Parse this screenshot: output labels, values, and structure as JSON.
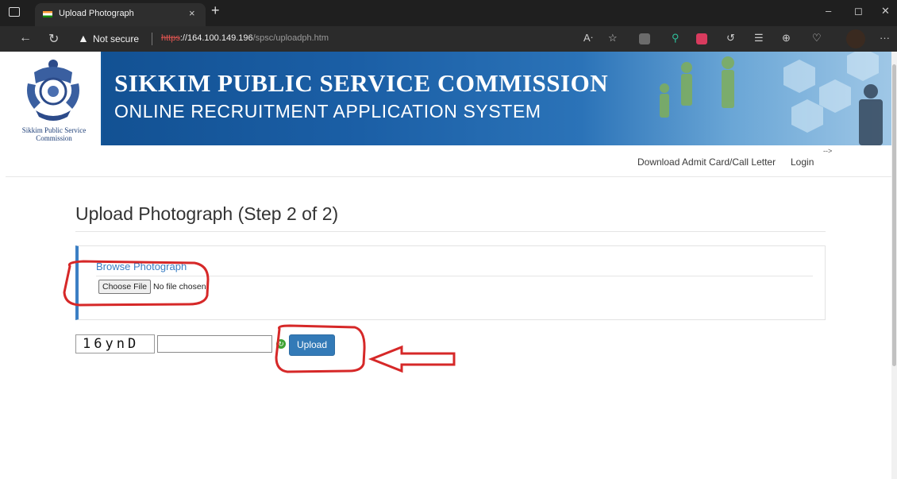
{
  "browser": {
    "tab_title": "Upload Photograph",
    "tab_close": "×",
    "new_tab": "+",
    "security_label": "Not secure",
    "url_scheme": "https",
    "url_host": "://164.100.149.196",
    "url_path": "/spsc/uploadph.htm",
    "controls": {
      "minimize": "–",
      "restore": "◻",
      "close": "✕"
    }
  },
  "banner": {
    "emblem_caption": "Sikkim Public Service Commission",
    "title": "SIKKIM PUBLIC SERVICE COMMISSION",
    "subtitle": "ONLINE RECRUITMENT APPLICATION SYSTEM"
  },
  "nav": {
    "items": [
      {
        "label": "Download Admit Card/Call Letter"
      },
      {
        "label": "Login"
      }
    ],
    "stray_text": "-->"
  },
  "main": {
    "heading": "Upload Photograph (Step 2 of 2)",
    "panel": {
      "legend": "Browse Photograph",
      "file_button": "Choose File",
      "file_status": "No file chosen"
    },
    "captcha": {
      "code": "16ynD",
      "input_value": ""
    },
    "upload_button": "Upload"
  },
  "colors": {
    "accent": "#337ab7",
    "banner": "#1b5fa6",
    "annotation": "#d62828"
  },
  "icons": {
    "window": "window-icon",
    "back": "back-arrow-icon",
    "refresh": "refresh-icon",
    "warning": "warning-icon",
    "captcha_refresh": "captcha-refresh-icon"
  }
}
